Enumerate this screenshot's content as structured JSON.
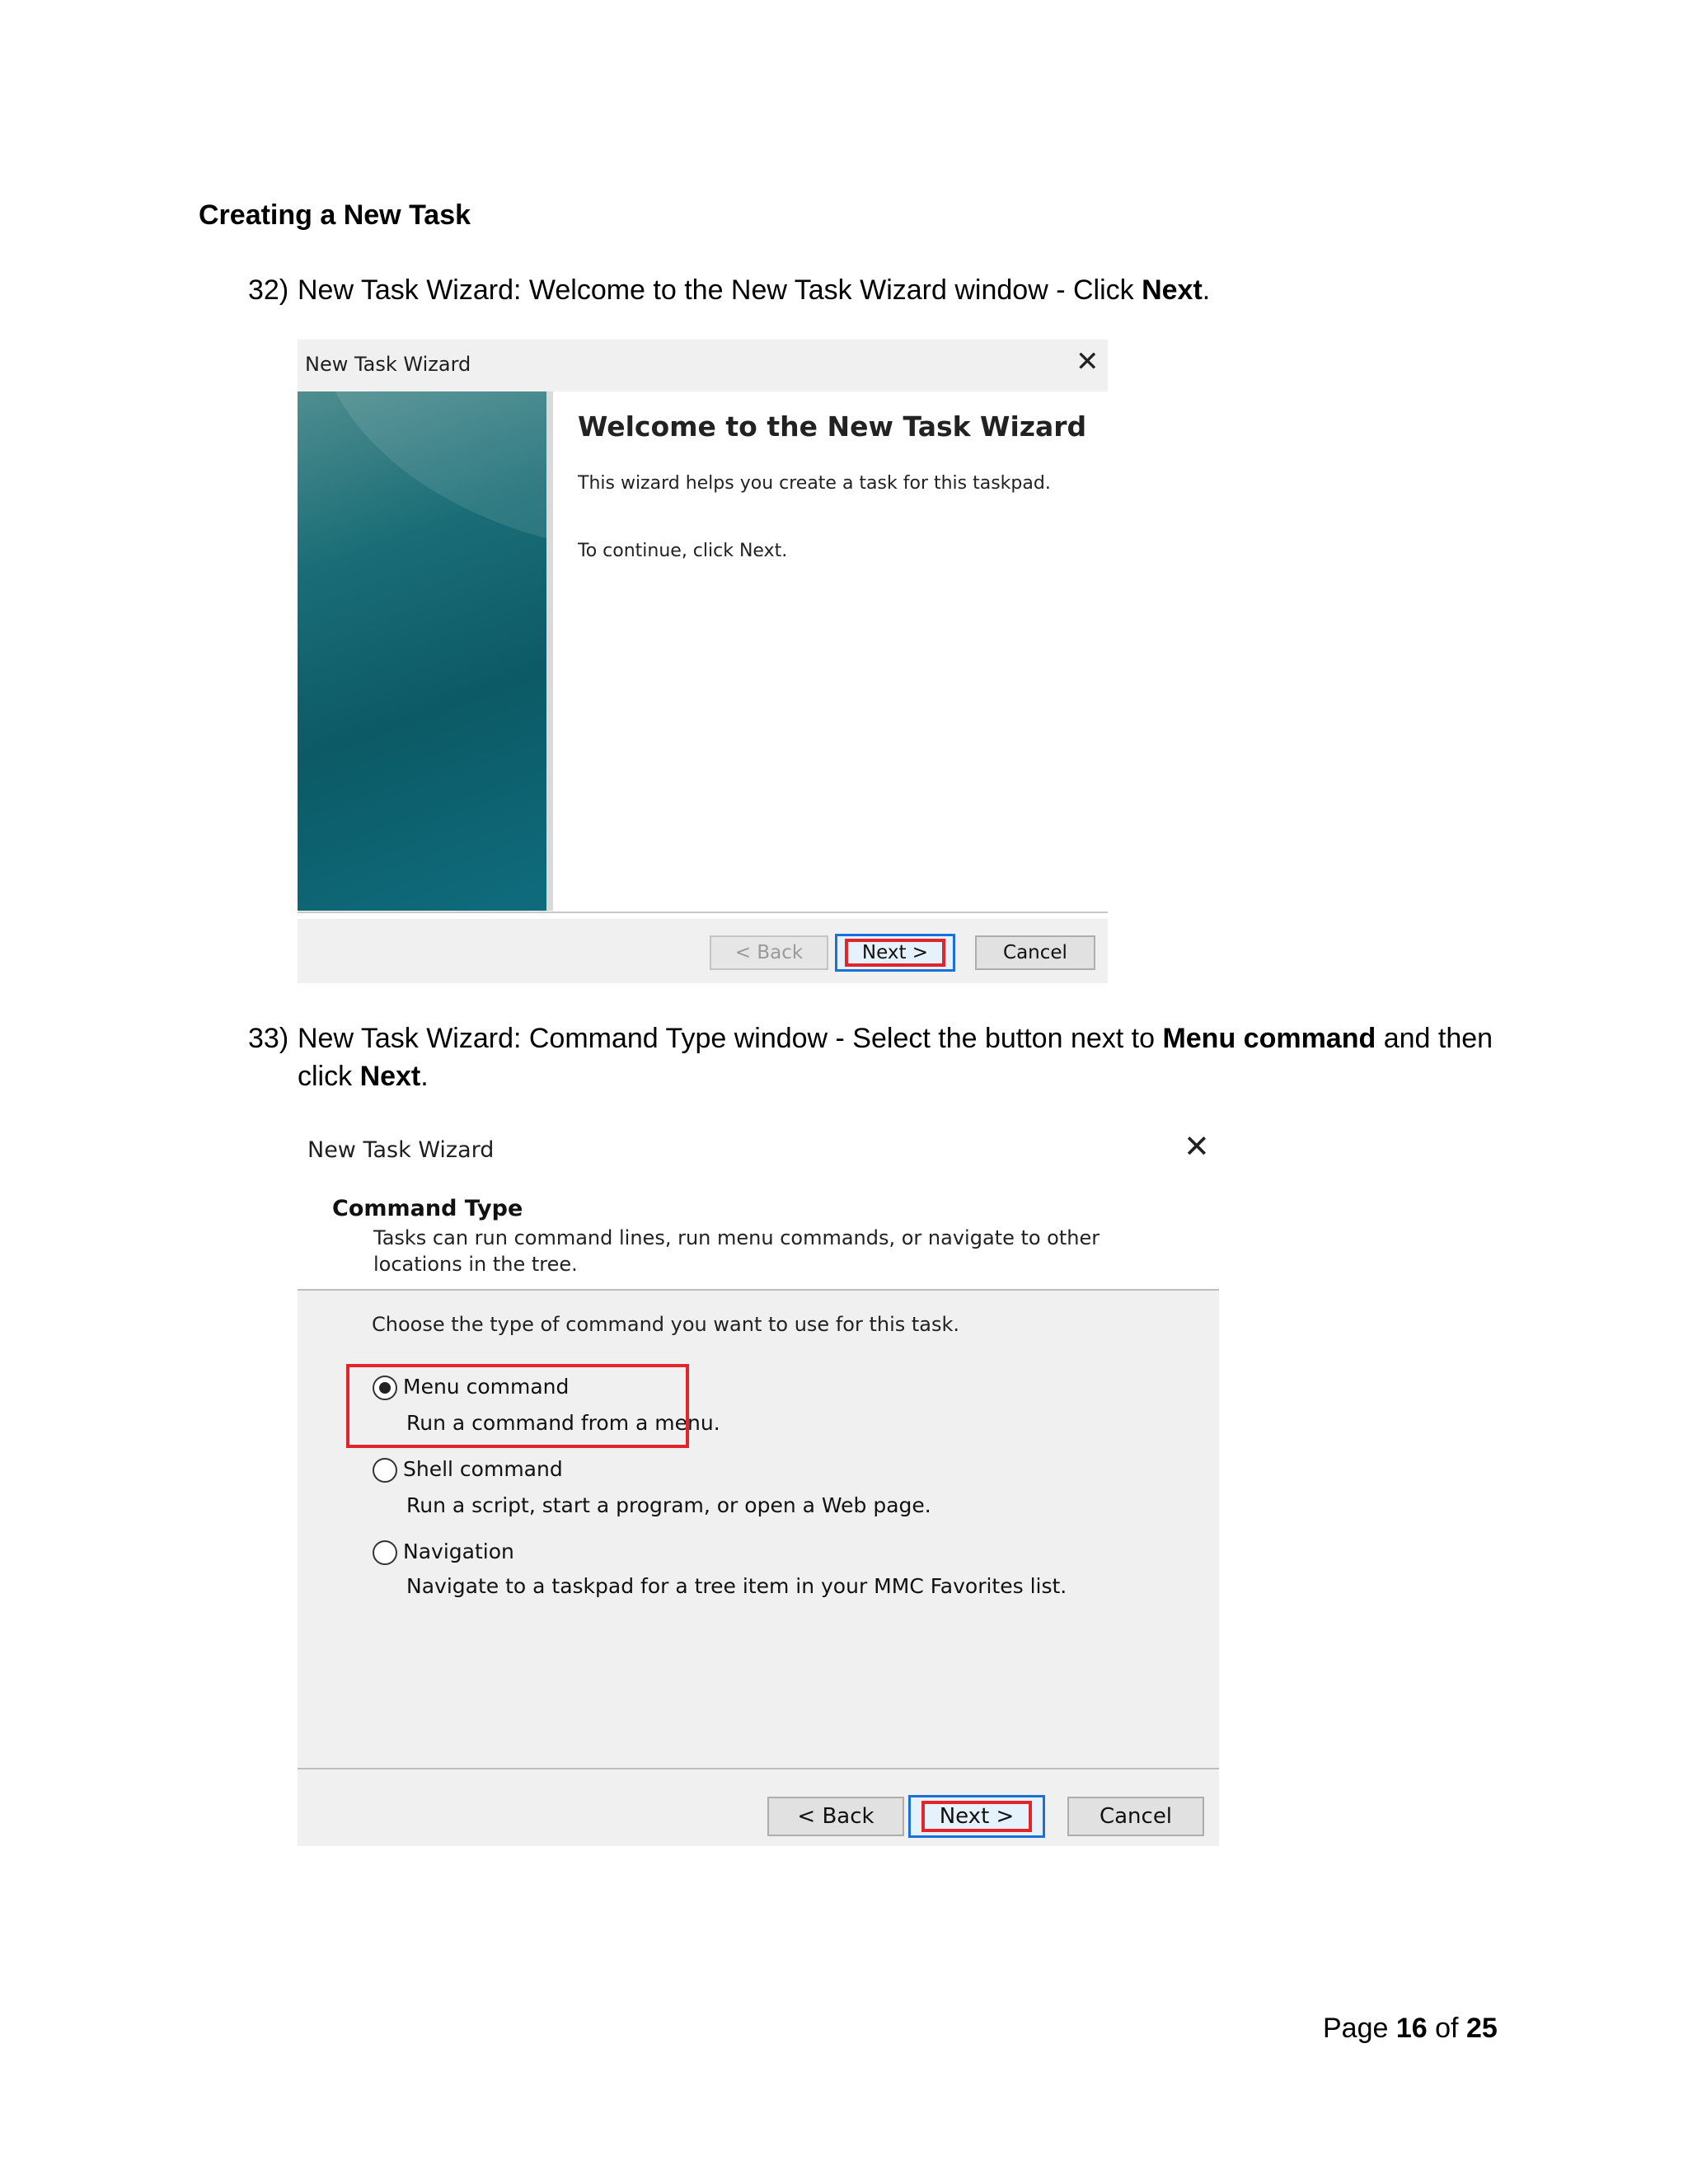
{
  "document": {
    "heading": "Creating a New Task",
    "step32": {
      "number": "32)",
      "text_before": "New Task Wizard: Welcome to the New Task Wizard window - Click ",
      "bold": "Next",
      "text_after": "."
    },
    "step33": {
      "number": "33)",
      "text_before": "New Task Wizard: Command Type window - Select the button next to ",
      "bold1": "Menu command",
      "text_mid": " and then",
      "line2_before": "click ",
      "bold2": "Next",
      "line2_after": "."
    },
    "footer": {
      "page_word": "Page ",
      "current": "16",
      "of_word": " of ",
      "total": "25"
    }
  },
  "dialog1": {
    "title": "New Task Wizard",
    "close_icon": "close-icon",
    "welcome_title": "Welcome to the New Task Wizard",
    "description": "This wizard helps you create a task for this taskpad.",
    "continue_text": "To continue, click Next.",
    "buttons": {
      "back": "< Back",
      "next": "Next >",
      "cancel": "Cancel"
    },
    "highlight_color": "#e0262b"
  },
  "dialog2": {
    "title": "New Task Wizard",
    "close_icon": "close-icon",
    "section_title": "Command Type",
    "section_desc": "Tasks can run command lines, run menu commands, or navigate to other locations in the tree.",
    "prompt": "Choose the type of command you want to use for this task.",
    "options": [
      {
        "label": "Menu command",
        "desc": "Run a command from a menu.",
        "selected": true
      },
      {
        "label": "Shell command",
        "desc": "Run a script, start a program, or open a Web page.",
        "selected": false
      },
      {
        "label": "Navigation",
        "desc": "Navigate to a taskpad for a tree item in your MMC Favorites list.",
        "selected": false
      }
    ],
    "buttons": {
      "back": "< Back",
      "next": "Next >",
      "cancel": "Cancel"
    },
    "highlight_color": "#e0262b",
    "focus_color": "#1a6fd8"
  }
}
